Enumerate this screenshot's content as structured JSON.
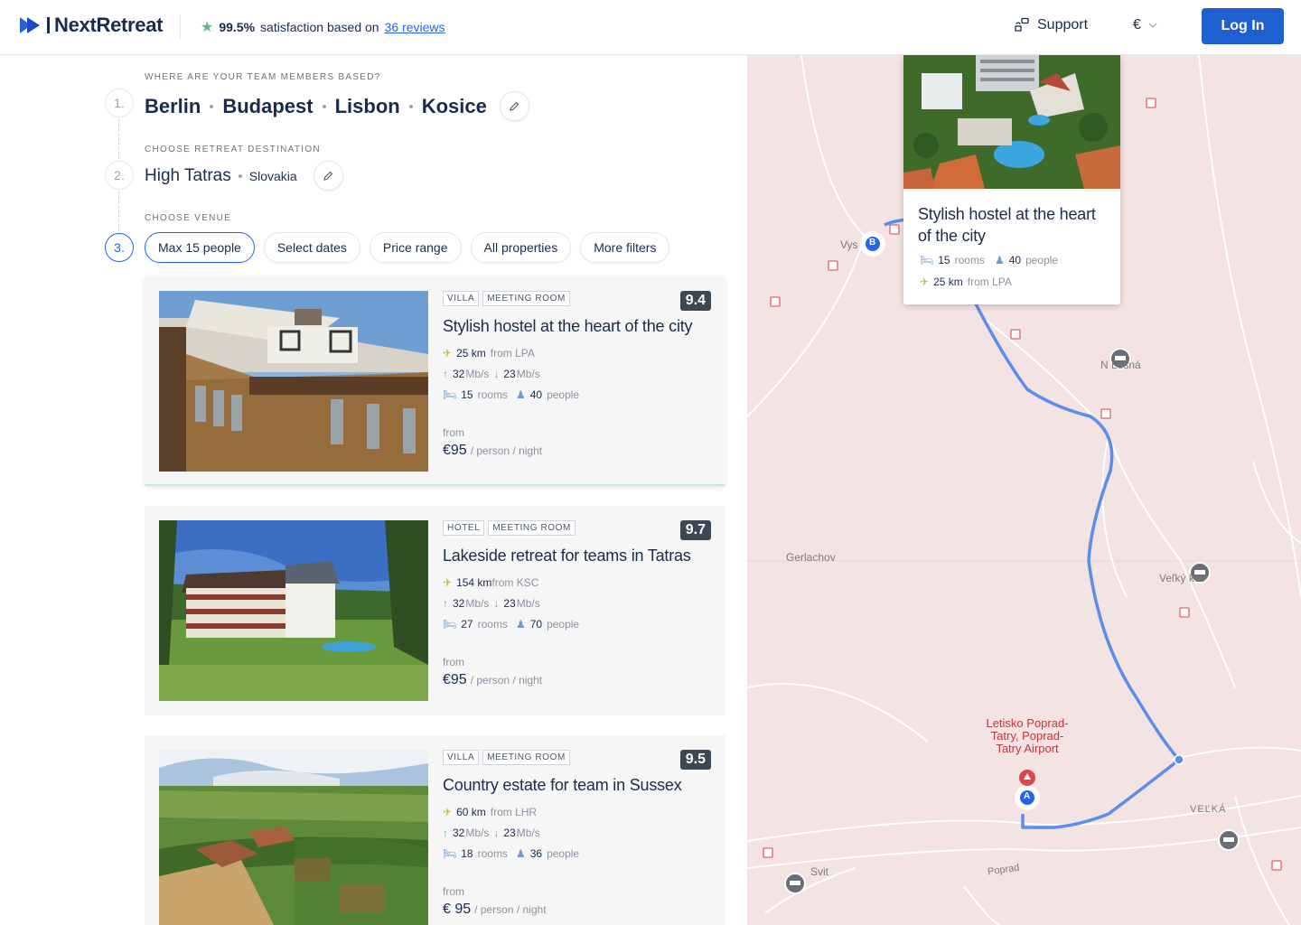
{
  "header": {
    "logo_text": "NextRetreat",
    "rating_percent": "99.5%",
    "rating_text": "satisfaction based on",
    "reviews_link": "36 reviews",
    "support_label": "Support",
    "currency": "€",
    "login_label": "Log In"
  },
  "steps": {
    "one": {
      "number": "1.",
      "label": "WHERE ARE YOUR TEAM MEMBERS BASED?",
      "cities": [
        "Berlin",
        "Budapest",
        "Lisbon",
        "Kosice"
      ]
    },
    "two": {
      "number": "2.",
      "label": "CHOOSE RETREAT DESTINATION",
      "destination": "High Tatras",
      "country": "Slovakia"
    },
    "three": {
      "number": "3.",
      "label": "CHOOSE VENUE"
    }
  },
  "filters": [
    "Max 15 people",
    "Select dates",
    "Price range",
    "All properties",
    "More filters"
  ],
  "venues": [
    {
      "tags": [
        "VILLA",
        "MEETING ROOM"
      ],
      "score": "9.4",
      "title": "Stylish hostel at the heart of the city",
      "distance": "25 km",
      "distance_from": "from LPA",
      "upload": "32",
      "upload_unit": "Mb/s",
      "download": "23",
      "download_unit": "Mb/s",
      "rooms": "15",
      "rooms_label": "rooms",
      "people": "40",
      "people_label": "people",
      "from_label": "from",
      "price": "€95",
      "price_unit": "/ person / night"
    },
    {
      "tags": [
        "HOTEL",
        "MEETING ROOM"
      ],
      "score": "9.7",
      "title": "Lakeside retreat for teams in Tatras",
      "distance": "154 km",
      "distance_from": "from KSC",
      "upload": "32",
      "upload_unit": "Mb/s",
      "download": "23",
      "download_unit": "Mb/s",
      "rooms": "27",
      "rooms_label": "rooms",
      "people": "70",
      "people_label": "people",
      "from_label": "from",
      "price": "€95",
      "price_unit": "/ person / night"
    },
    {
      "tags": [
        "VILLA",
        "MEETING ROOM"
      ],
      "score": "9.5",
      "title": "Country estate for team in Sussex",
      "distance": "60 km",
      "distance_from": "from LHR",
      "upload": "32",
      "upload_unit": "Mb/s",
      "download": "23",
      "download_unit": "Mb/s",
      "rooms": "18",
      "rooms_label": "rooms",
      "people": "36",
      "people_label": "people",
      "from_label": "from",
      "price": "€ 95",
      "price_unit": "/ person / night"
    }
  ],
  "map": {
    "popup": {
      "title": "Stylish hostel at the heart of the city",
      "rooms": "15",
      "rooms_label": "rooms",
      "people": "40",
      "people_label": "people",
      "distance": "25 km",
      "distance_from": "from LPA"
    },
    "labels": {
      "vysoke": "Vys",
      "nova_lesna": "N   Lesná",
      "gerlachov": "Gerlachov",
      "velky": "Veľký      kov",
      "velka": "VEĽKÁ",
      "svit": "Svit",
      "poprad": "Poprad"
    },
    "airport": "Letisko Poprad-Tatry, Poprad-Tatry Airport",
    "marker_a": "A",
    "marker_b": "B"
  },
  "colors": {
    "accent": "#1e5fd1",
    "route": "#5b8def",
    "map_bg": "#f3e3e3",
    "score_bg": "#3d4855"
  }
}
